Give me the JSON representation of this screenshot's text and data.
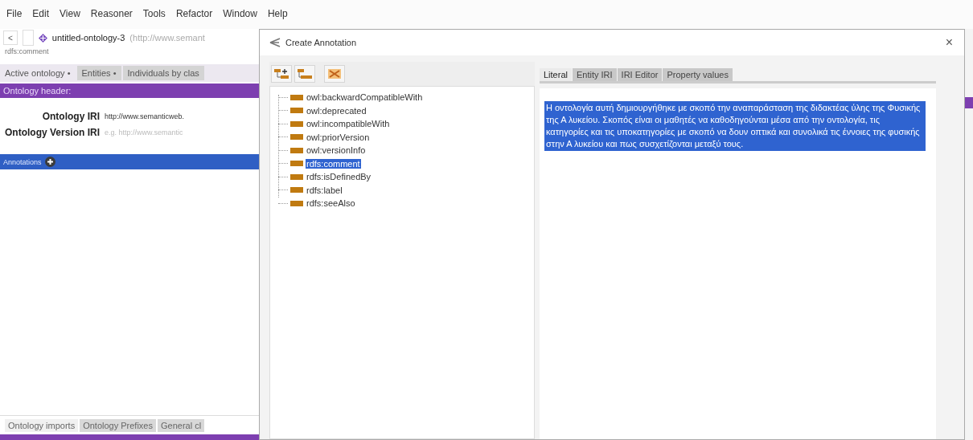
{
  "menu": [
    "File",
    "Edit",
    "View",
    "Reasoner",
    "Tools",
    "Refactor",
    "Window",
    "Help"
  ],
  "toolbar": {
    "back": "<",
    "ontology_name": "untitled-ontology-3",
    "ontology_iri": "(http://www.semant"
  },
  "breadcrumb": "rdfs:comment",
  "tabs": [
    {
      "label": "Active ontology •",
      "selected": true
    },
    {
      "label": "Entities •",
      "selected": false
    },
    {
      "label": "Individuals by clas",
      "selected": false
    }
  ],
  "header": {
    "title": "Ontology header:",
    "fields": [
      {
        "label": "Ontology IRI",
        "value": "http://www.semanticweb."
      },
      {
        "label": "Ontology Version IRI",
        "placeholder": "e.g. http://www.semantic"
      }
    ]
  },
  "annotations_bar": {
    "title": "Annotations"
  },
  "bottom_tabs": [
    {
      "label": "Ontology imports",
      "selected": true
    },
    {
      "label": "Ontology Prefixes",
      "selected": false
    },
    {
      "label": "General cl",
      "selected": false
    }
  ],
  "dialog": {
    "title": "Create Annotation",
    "close": "×",
    "properties": [
      {
        "label": "owl:backwardCompatibleWith",
        "selected": false
      },
      {
        "label": "owl:deprecated",
        "selected": false
      },
      {
        "label": "owl:incompatibleWith",
        "selected": false
      },
      {
        "label": "owl:priorVersion",
        "selected": false
      },
      {
        "label": "owl:versionInfo",
        "selected": false
      },
      {
        "label": "rdfs:comment",
        "selected": true
      },
      {
        "label": "rdfs:isDefinedBy",
        "selected": false
      },
      {
        "label": "rdfs:label",
        "selected": false
      },
      {
        "label": "rdfs:seeAlso",
        "selected": false
      }
    ],
    "tabs": [
      {
        "label": "Literal",
        "selected": true
      },
      {
        "label": "Entity IRI",
        "selected": false
      },
      {
        "label": "IRI Editor",
        "selected": false
      },
      {
        "label": "Property values",
        "selected": false
      }
    ],
    "literal": {
      "text": "Η οντολογία αυτή δημιουργήθηκε με σκοπό την αναπαράσταση της διδακτέας ύλης της Φυσικής της Α λυκείου. Σκοπός είναι οι μαθητές να καθοδηγούνται μέσα από την οντολογία, τις κατηγορίες και τις υποκατηγορίες με σκοπό να δουν οπτικά και συνολικά τις έννοιες της φυσικής στην Α λυκείου και πως συσχετίζονται μεταξύ τους.",
      "selected": true
    }
  }
}
